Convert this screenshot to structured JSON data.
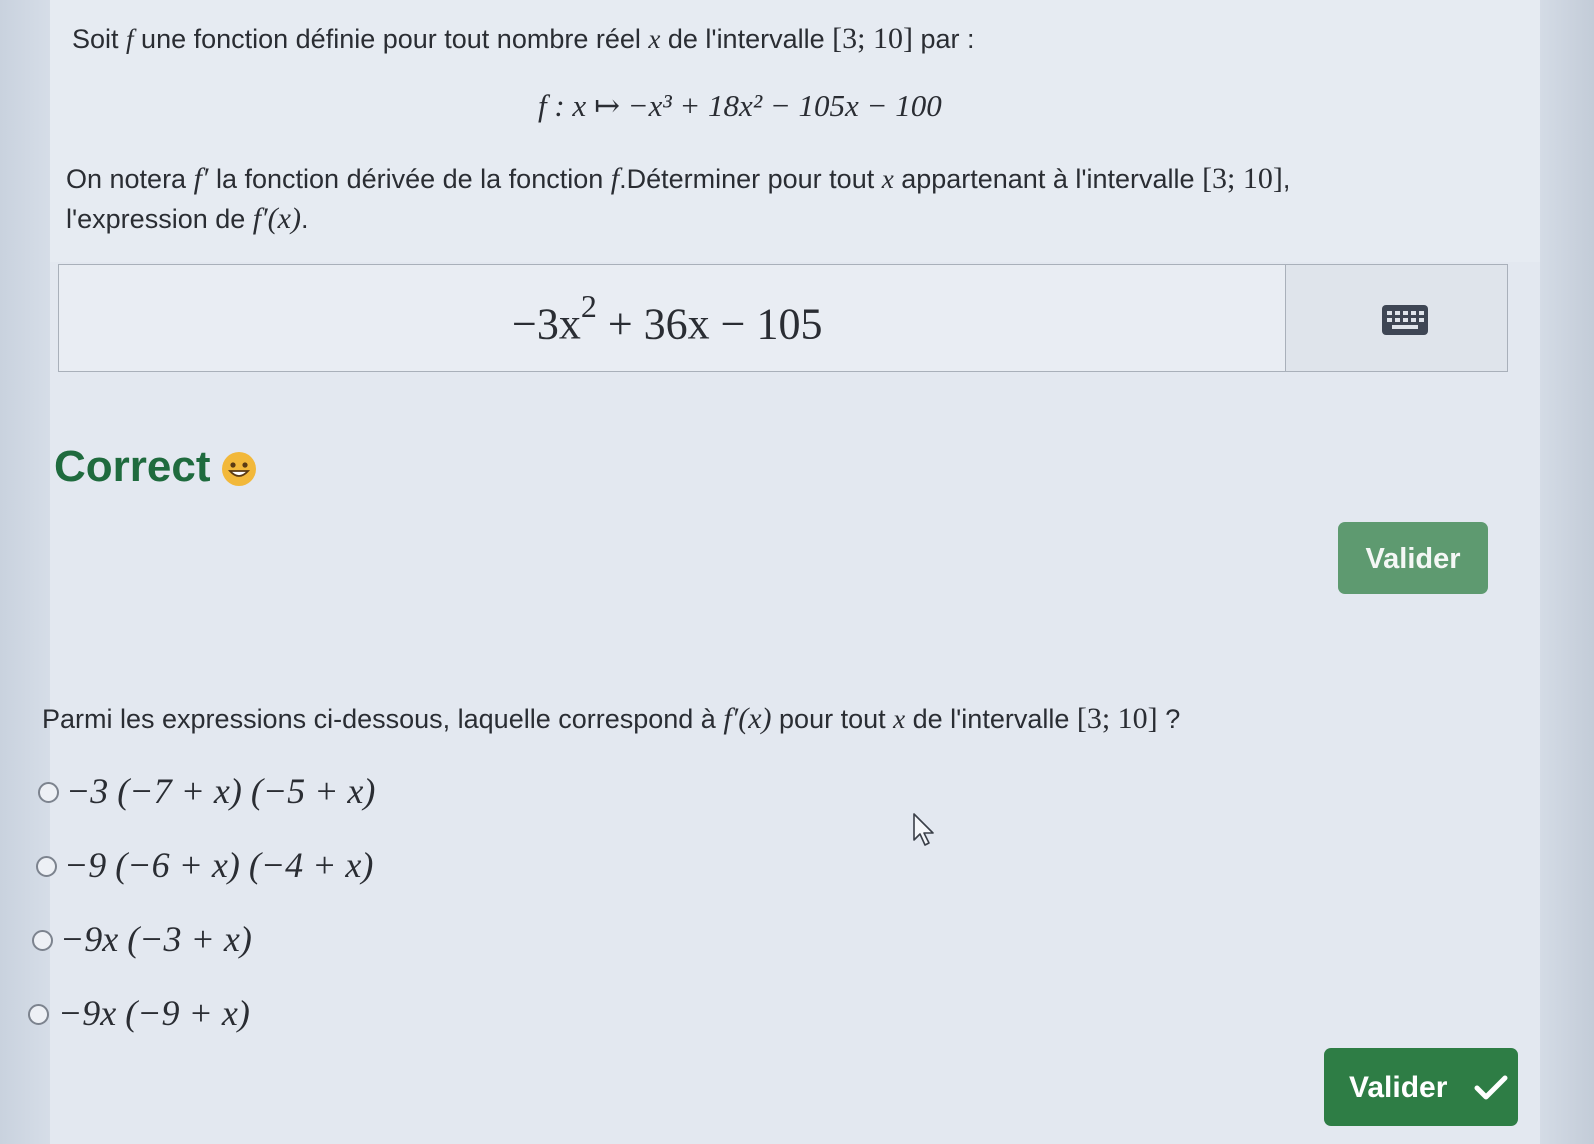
{
  "problem": {
    "line1_a": "Soit ",
    "line1_f": "f",
    "line1_b": " une fonction définie pour tout nombre réel ",
    "line1_x": "x",
    "line1_c": " de l'intervalle ",
    "line1_interval": "[3; 10]",
    "line1_d": " par :",
    "function_def": "f : x ↦ −x³ + 18x² − 105x − 100",
    "line3_a": "On notera ",
    "line3_fprime": "f′",
    "line3_b": " la fonction dérivée de la fonction ",
    "line3_f": "f",
    "line3_c": ".Déterminer pour tout ",
    "line3_x": "x",
    "line3_d": " appartenant à l'intervalle ",
    "line3_interval": "[3; 10]",
    "line3_e": ",",
    "line4_a": "l'expression de ",
    "line4_expr": "f′(x)",
    "line4_b": "."
  },
  "answer": {
    "value_part1": "−3x",
    "value_exp": "2",
    "value_part2": " + 36x − 105",
    "keyboard_icon": "keyboard-icon"
  },
  "feedback": {
    "text": "Correct",
    "emoji_icon": "grinning-face-icon"
  },
  "buttons": {
    "validate_1": "Valider",
    "validate_2": "Valider"
  },
  "question2": {
    "text_a": "Parmi les expressions ci-dessous, laquelle correspond à ",
    "text_expr": "f′(x)",
    "text_b": " pour tout ",
    "text_x": "x",
    "text_c": " de l'intervalle ",
    "text_interval": "[3; 10]",
    "text_d": " ?",
    "options": [
      "−3 (−7 + x) (−5 + x)",
      "−9 (−6 + x) (−4 + x)",
      "−9x (−3 + x)",
      "−9x (−9 + x)"
    ]
  },
  "colors": {
    "correct_green": "#1f6b3e",
    "validate_disabled": "#5e9a70",
    "validate_active": "#2e7d45"
  }
}
